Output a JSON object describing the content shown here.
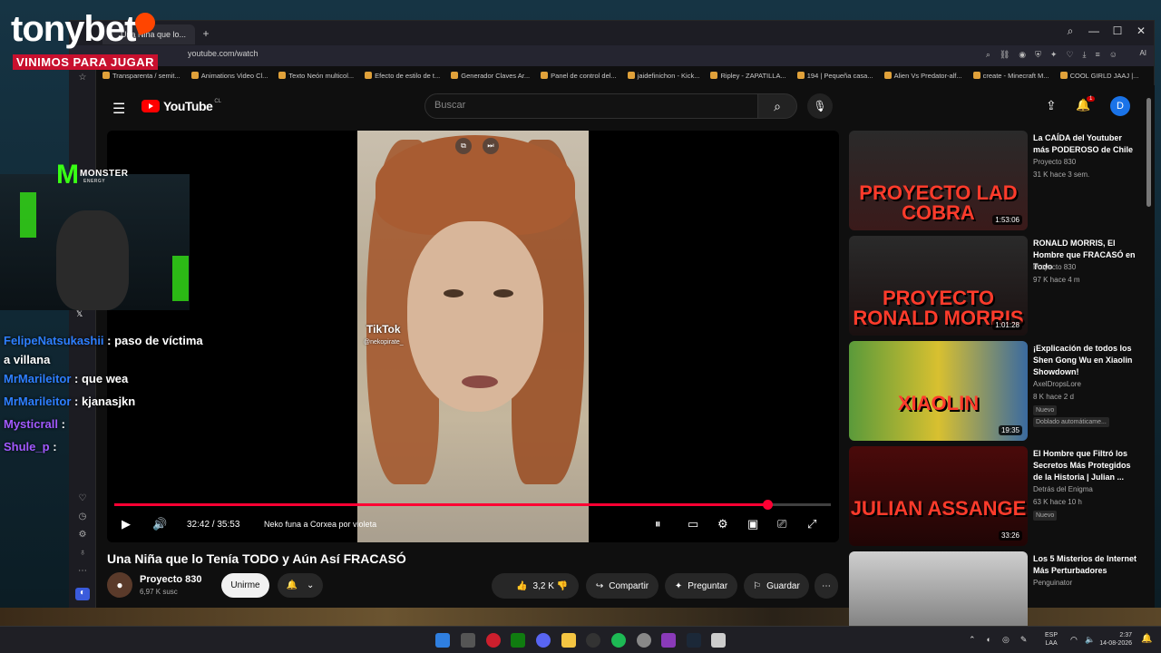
{
  "overlay": {
    "brand": "tonybet",
    "tagline": "VINIMOS PARA JUGAR",
    "sponsor": "MONSTER",
    "sponsor_sub": "ENERGY"
  },
  "browser": {
    "tab_title": "Una Niña que lo...",
    "url": "youtube.com/watch",
    "ai_label": "AI",
    "bookmarks": [
      "Transparenta / semit...",
      "Animations Video Cl...",
      "Texto Neón multicol...",
      "Efecto de estilo de t...",
      "Generador Claves Ar...",
      "Panel de control del...",
      "jaidefinichon - Kick...",
      "Ripley - ZAPATILLA...",
      "194 | Pequeña casa...",
      "Alien Vs Predator-alf...",
      "create - Minecraft M...",
      "COOL GIRLD JAAJ |..."
    ]
  },
  "youtube": {
    "logo_text": "YouTube",
    "region": "CL",
    "search_placeholder": "Buscar",
    "notif_count": "1",
    "avatar_letter": "D",
    "player": {
      "tiktok_label": "TikTok",
      "tiktok_handle": "@nekopirate_",
      "time": "32:42 / 35:53",
      "chapter": "Neko funa a Corxea por violeta",
      "progress": 0.911
    },
    "video": {
      "title": "Una Niña que lo Tenía TODO y Aún Así FRACASÓ",
      "channel": "Proyecto 830",
      "subs": "6,97 K susc",
      "join": "Unirme",
      "likes": "3,2 K",
      "share": "Compartir",
      "ask": "Preguntar",
      "save": "Guardar"
    },
    "recommendations": [
      {
        "thumb_text": "PROYECTO LAD COBRA",
        "duration": "1:53:06",
        "title": "La CAÍDA del Youtuber más PODEROSO de Chile",
        "channel": "Proyecto 830",
        "meta": "31 K  hace 3 sem."
      },
      {
        "thumb_text": "PROYECTO RONALD MORRIS",
        "duration": "1:01:28",
        "title": "RONALD MORRIS, El Hombre que FRACASÓ en Todo",
        "channel": "Proyecto 830",
        "meta": "97 K  hace 4 m"
      },
      {
        "thumb_text": "XIAOLIN",
        "duration": "19:35",
        "title": "¡Explicación de todos los Shen Gong Wu en Xiaolin Showdown!",
        "channel": "AxelDropsLore",
        "meta": "8 K  hace 2 d",
        "tag": "Nuevo",
        "tag2": "Doblado automáticame..."
      },
      {
        "thumb_text": "JULIAN ASSANGE",
        "duration": "33:26",
        "title": "El Hombre que Filtró los Secretos Más Protegidos de la Historia | Julian ...",
        "channel": "Detrás del Enigma",
        "meta": "63 K  hace 10 h",
        "tag": "Nuevo"
      },
      {
        "thumb_text": "",
        "duration": "",
        "title": "Los 5 Misterios de Internet Más Perturbadores",
        "channel": "Penguinator",
        "meta": ""
      }
    ]
  },
  "chat": [
    {
      "user": "FelipeNatsukashii",
      "text": ": paso de víctima a villana",
      "color": "#2e7fff"
    },
    {
      "user": "MrMarileitor",
      "text": ": que wea",
      "color": "#2e7fff"
    },
    {
      "user": "MrMarileitor",
      "text": ": kjanasjkn",
      "color": "#2e7fff"
    },
    {
      "user": "Mysticrall",
      "text": ":",
      "color": "#a259ff"
    },
    {
      "user": "Shule_p",
      "text": ":",
      "color": "#a259ff"
    }
  ],
  "taskbar": {
    "lang": "ESP",
    "lang2": "LAA",
    "time": "2:37",
    "date": "14-08-2026"
  }
}
